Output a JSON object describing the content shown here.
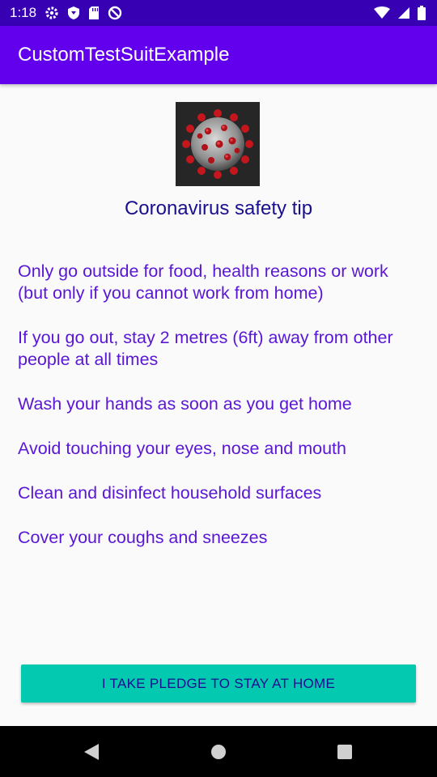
{
  "status_bar": {
    "time": "1:18",
    "icons_left": [
      "gear-icon",
      "shield-icon",
      "sd-card-icon",
      "no-sign-icon"
    ],
    "icons_right": [
      "wifi-icon",
      "signal-icon",
      "battery-icon"
    ]
  },
  "app_bar": {
    "title": "CustomTestSuitExample"
  },
  "main": {
    "image": {
      "icon": "coronavirus-image"
    },
    "heading": "Coronavirus safety tip",
    "tips": [
      "Only go outside for food, health reasons or work (but only if you cannot work from home)",
      "If you go out, stay 2 metres (6ft) away from other people at all times",
      "Wash your hands as soon as you get home",
      "Avoid touching your eyes, nose and mouth",
      "Clean and disinfect household surfaces",
      "Cover your coughs and sneezes"
    ],
    "pledge_button_label": "I TAKE PLEDGE TO STAY AT HOME"
  },
  "nav_bar": {
    "icons": [
      "back-icon",
      "home-icon",
      "recents-icon"
    ]
  },
  "colors": {
    "status_bar": "#3700b3",
    "app_bar": "#6200ee",
    "heading_text": "#1a0f8f",
    "tip_text": "#5a16d6",
    "button": "#03c9b1",
    "background": "#fafafa"
  }
}
